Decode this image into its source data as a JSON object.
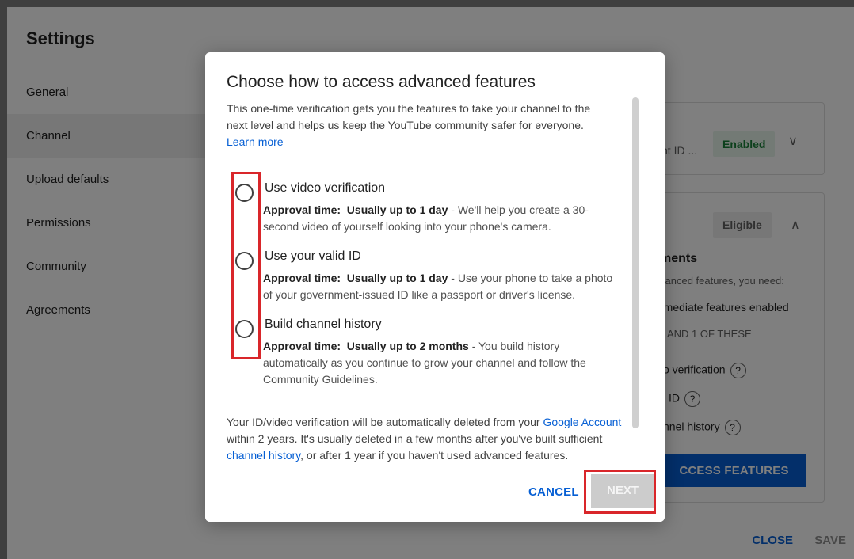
{
  "settings": {
    "title": "Settings",
    "sidebar": [
      {
        "label": "General"
      },
      {
        "label": "Channel"
      },
      {
        "label": "Upload defaults"
      },
      {
        "label": "Permissions"
      },
      {
        "label": "Community"
      },
      {
        "label": "Agreements"
      }
    ],
    "background": {
      "card1_text": "nt ID ...",
      "card1_badge": "Enabled",
      "card2_badge": "Eligible",
      "req_title": "ments",
      "req_sub": "vanced features, you need:",
      "req_item1": "rmediate features enabled",
      "req_divider": "AND 1 OF THESE",
      "req_opt1": "o verification",
      "req_opt2": "l ID",
      "req_opt3": "nnel history",
      "help_glyph": "?",
      "access_button": "CCESS FEATURES"
    },
    "footer": {
      "close": "CLOSE",
      "save": "SAVE"
    }
  },
  "dialog": {
    "title": "Choose how to access advanced features",
    "intro": "This one-time verification gets you the features to take your channel to the next level and helps us keep the YouTube community safer for everyone.",
    "learn_more": "Learn more",
    "options": [
      {
        "title": "Use video verification",
        "approval_label": "Approval time:",
        "approval_value": "Usually up to 1 day",
        "desc": " - We'll help you create a 30-second video of yourself looking into your phone's camera."
      },
      {
        "title": "Use your valid ID",
        "approval_label": "Approval time:",
        "approval_value": "Usually up to 1 day",
        "desc": " - Use your phone to take a photo of your government-issued ID like a passport or driver's license."
      },
      {
        "title": "Build channel history",
        "approval_label": "Approval time:",
        "approval_value": "Usually up to 2 months",
        "desc": " - You build history automatically as you continue to grow your channel and follow the Community Guidelines."
      }
    ],
    "note_pre": "Your ID/video verification will be automatically deleted from your ",
    "note_link1": "Google Account",
    "note_mid": " within 2 years. It's usually deleted in a few months after you've built sufficient ",
    "note_link2": "channel history",
    "note_post": ", or after 1 year if you haven't used advanced features.",
    "cancel": "CANCEL",
    "next": "NEXT"
  },
  "colors": {
    "accent": "#065fd4",
    "highlight": "#d9262a",
    "enabled_badge": "#188038"
  }
}
